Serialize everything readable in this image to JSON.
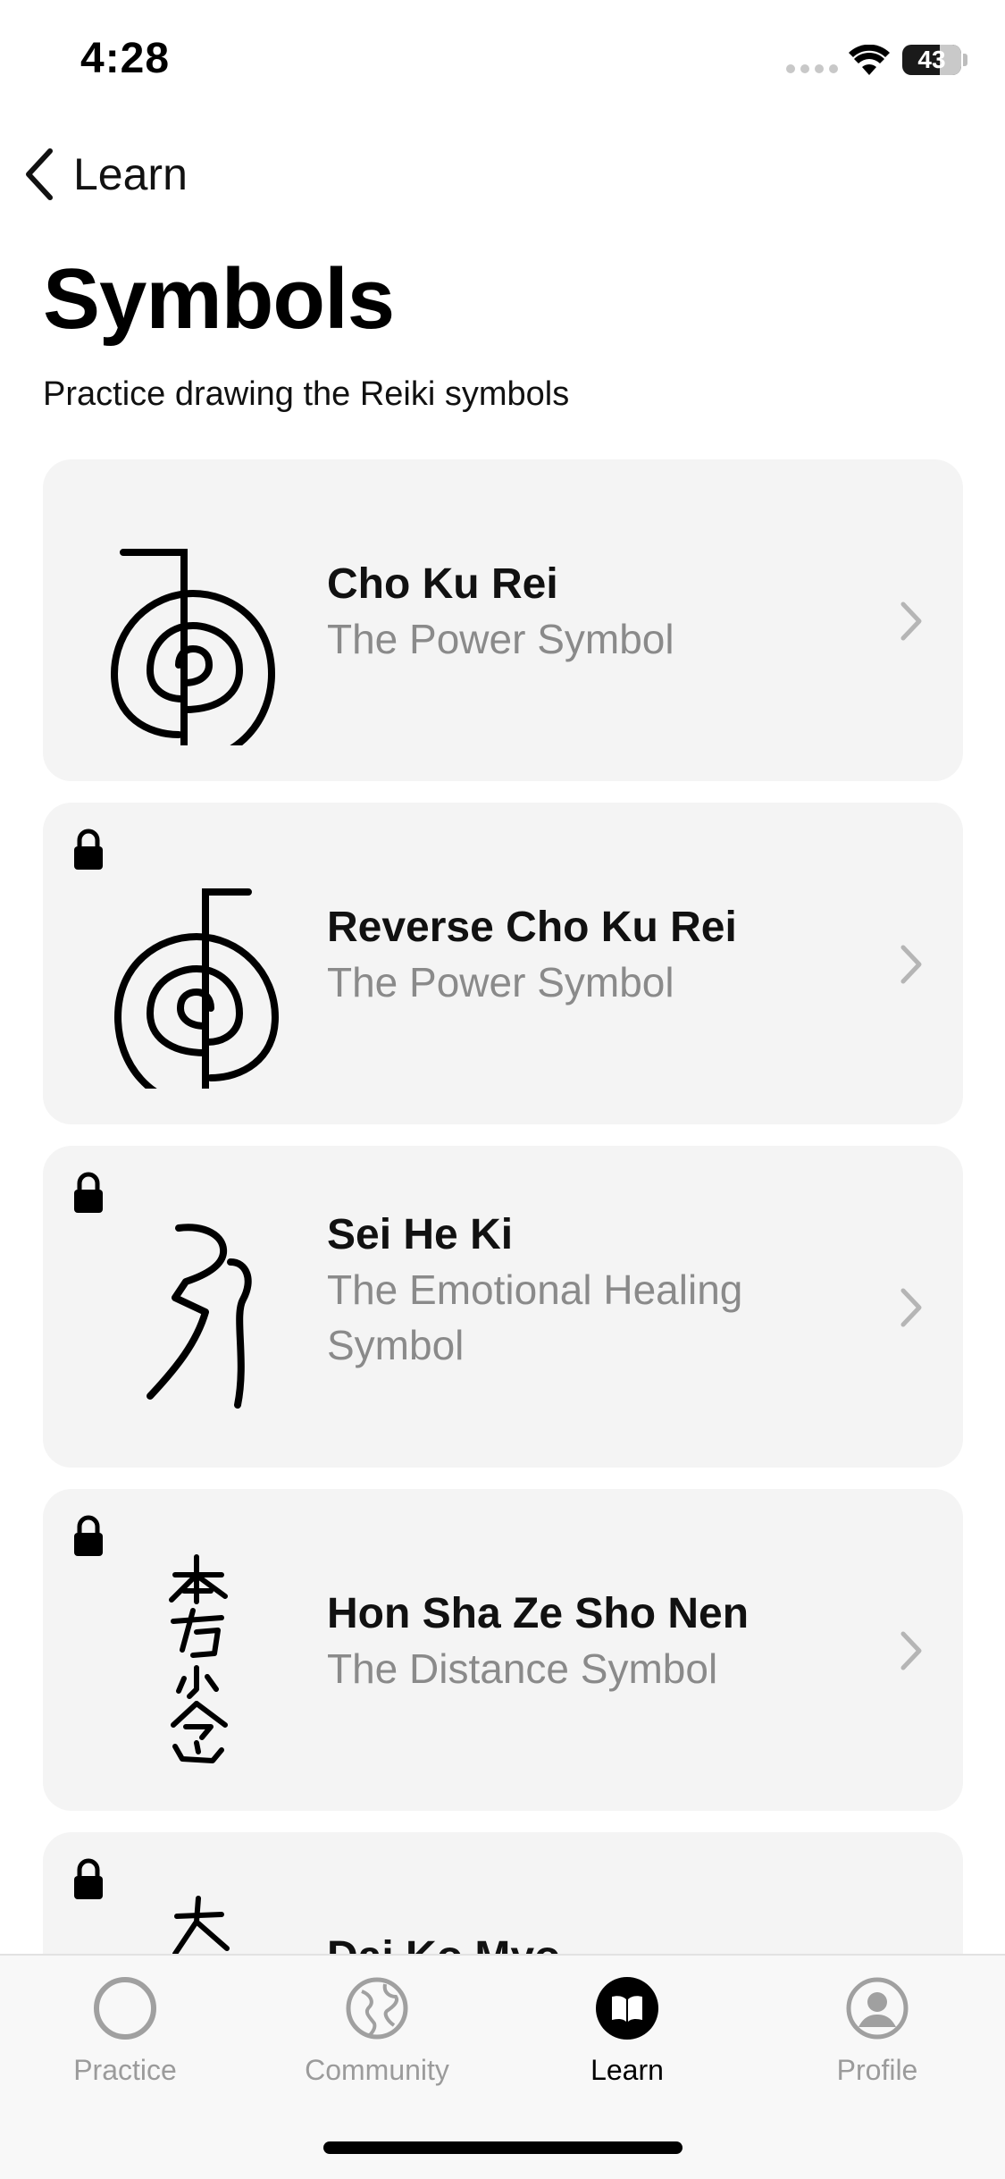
{
  "status": {
    "time": "4:28",
    "battery": "43"
  },
  "nav": {
    "back_label": "Learn"
  },
  "page": {
    "title": "Symbols",
    "subtitle": "Practice drawing the Reiki symbols"
  },
  "cards": [
    {
      "title": "Cho Ku Rei",
      "subtitle": "The Power Symbol",
      "locked": false,
      "icon": "cho-ku-rei-symbol"
    },
    {
      "title": "Reverse Cho Ku Rei",
      "subtitle": "The Power Symbol",
      "locked": true,
      "icon": "reverse-cho-ku-rei-symbol"
    },
    {
      "title": "Sei He Ki",
      "subtitle": "The Emotional Healing Symbol",
      "locked": true,
      "icon": "sei-he-ki-symbol"
    },
    {
      "title": "Hon Sha Ze Sho Nen",
      "subtitle": "The Distance Symbol",
      "locked": true,
      "icon": "hon-sha-ze-sho-nen-symbol"
    },
    {
      "title": "Dai Ko Myo",
      "subtitle": "",
      "locked": true,
      "icon": "dai-ko-myo-symbol"
    }
  ],
  "tabs": [
    {
      "label": "Practice",
      "icon": "circle-icon",
      "active": false
    },
    {
      "label": "Community",
      "icon": "globe-icon",
      "active": false
    },
    {
      "label": "Learn",
      "icon": "book-icon",
      "active": true
    },
    {
      "label": "Profile",
      "icon": "person-icon",
      "active": false
    }
  ],
  "colors": {
    "card_bg": "#f4f4f4",
    "subtitle_gray": "#8a8a8a",
    "tab_inactive": "#9b9b9b"
  }
}
